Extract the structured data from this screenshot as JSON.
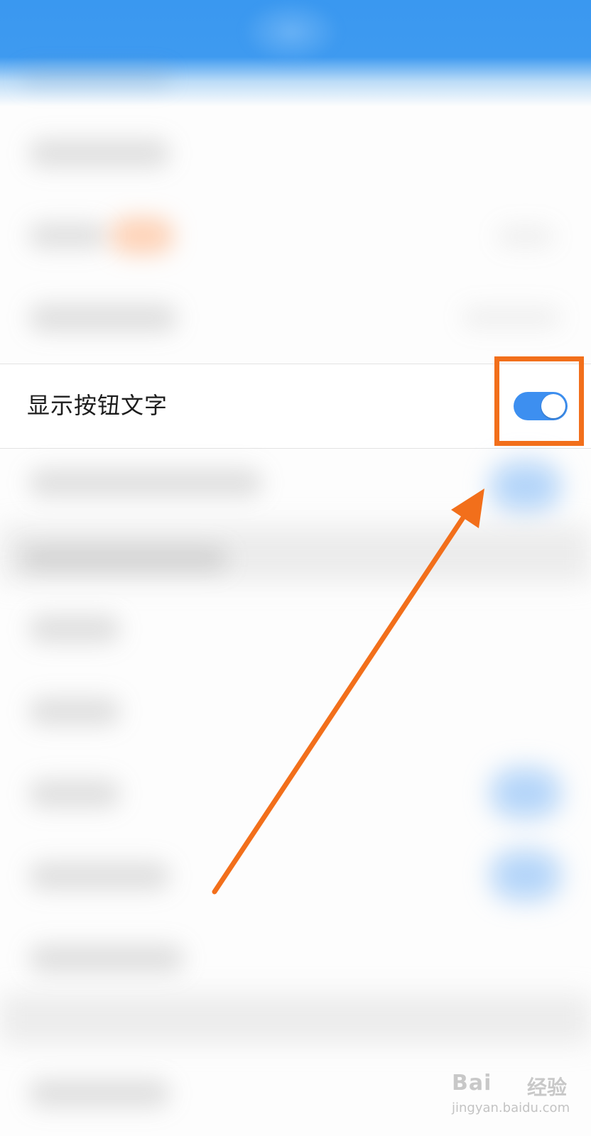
{
  "setting": {
    "label": "显示按钮文字",
    "toggle_on": true
  },
  "colors": {
    "header_blue": "#3e9af0",
    "toggle_on": "#3d8ff0",
    "annotation_orange": "#f26f1b"
  },
  "icons": {
    "toggle": "toggle-switch-icon",
    "arrow": "annotation-arrow-icon"
  },
  "watermark": {
    "brand": "Bai",
    "brand_cn": "经验",
    "url": "jingyan.baidu.com"
  }
}
